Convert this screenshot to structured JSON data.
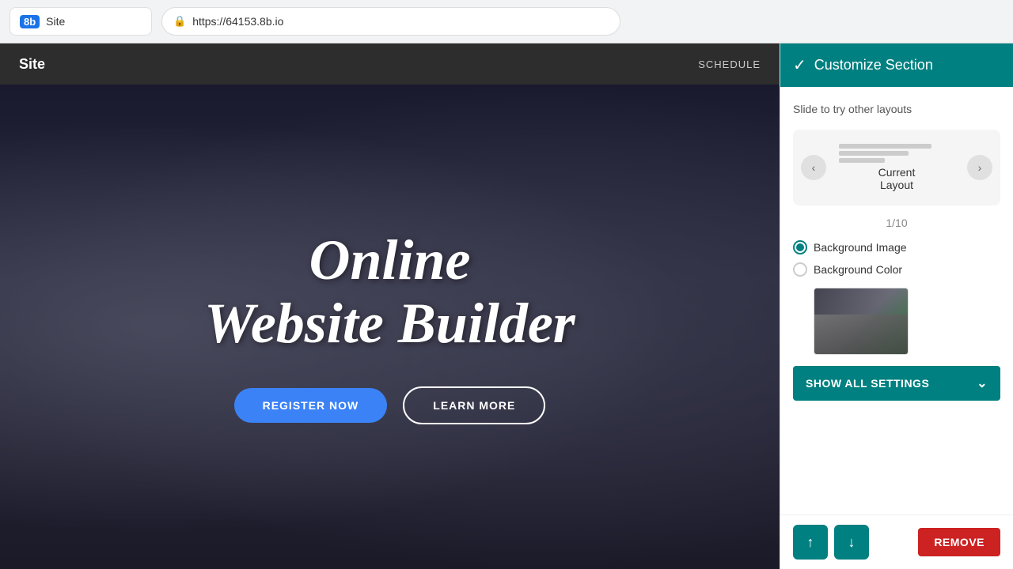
{
  "browser": {
    "logo_text": "8b",
    "site_label": "Site",
    "url": "https://64153.8b.io",
    "lock_icon": "🔒"
  },
  "site": {
    "nav_title": "Site",
    "nav_menu": "SCHEDULE"
  },
  "hero": {
    "title_line1": "Online",
    "title_line2": "Website Builder",
    "btn_register": "REGISTER NOW",
    "btn_learn": "LEARN MORE"
  },
  "panel": {
    "header_title": "Customize Section",
    "check_icon": "✓",
    "slide_hint": "Slide to try other layouts",
    "layout_label": "Current\nLayout",
    "layout_counter": "1/10",
    "bg_image_label": "Background Image",
    "bg_color_label": "Background Color",
    "show_settings_label": "SHOW ALL SETTINGS",
    "move_up_label": "↑",
    "move_down_label": "↓",
    "remove_label": "REMOVE"
  }
}
